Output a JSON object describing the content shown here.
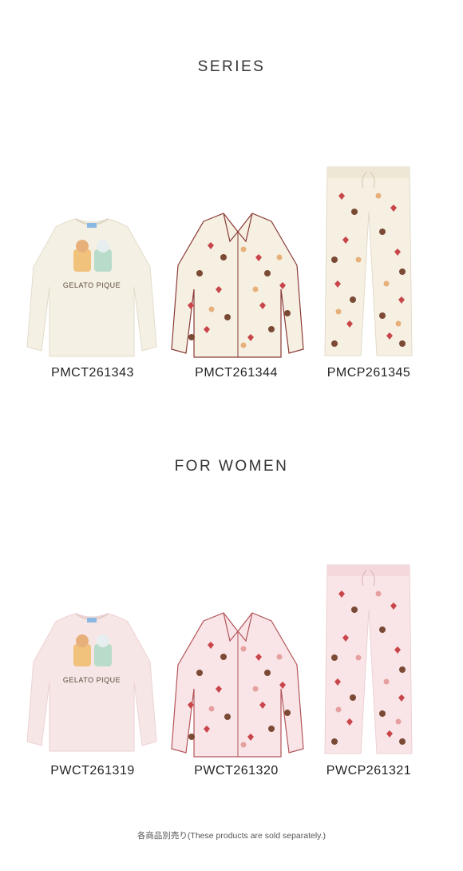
{
  "sections": [
    {
      "title": "SERIES",
      "products": [
        {
          "code": "PMCT261343",
          "type": "tshirt",
          "color": "#f5f0e4",
          "print_text": "GELATO PIQUE"
        },
        {
          "code": "PMCT261344",
          "type": "shirt",
          "color": "#f6f0e3"
        },
        {
          "code": "PMCP261345",
          "type": "pants",
          "color": "#f6f0e3"
        }
      ]
    },
    {
      "title": "FOR WOMEN",
      "products": [
        {
          "code": "PWCT261319",
          "type": "tshirt",
          "color": "#f7e6e6",
          "print_text": "GELATO PIQUE"
        },
        {
          "code": "PWCT261320",
          "type": "shirt",
          "color": "#f9e5e7"
        },
        {
          "code": "PWCP261321",
          "type": "pants",
          "color": "#f9e5e7"
        }
      ]
    }
  ],
  "footnote": "各商品別売り(These products are sold separately.)",
  "colors": {
    "heart": "#c8454a",
    "ball": "#7a4a35",
    "bear": "#e7b07a",
    "piping": "#8a3a36"
  }
}
